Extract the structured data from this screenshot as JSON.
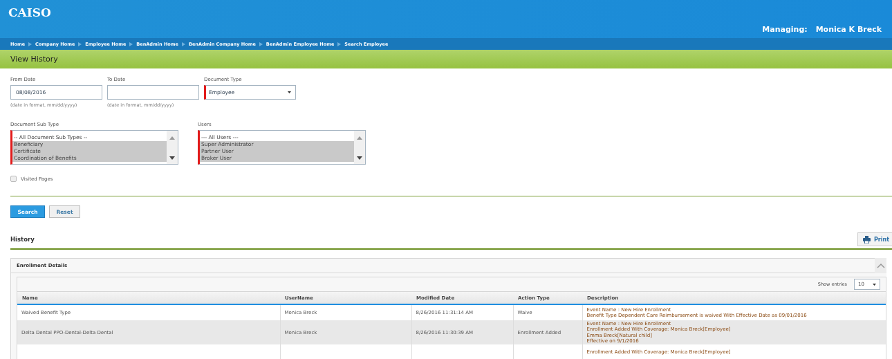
{
  "header": {
    "logo": "CAISO",
    "managing_label": "Managing:",
    "managing_name": "Monica K Breck"
  },
  "breadcrumbs": [
    "Home",
    "Company Home",
    "Employee Home",
    "BenAdmin Home",
    "BenAdmin Company Home",
    "BenAdmin Employee Home",
    "Search Employee"
  ],
  "page_title": "View History",
  "form": {
    "from_date": {
      "label": "From Date",
      "value": "08/08/2016",
      "hint": "(date in format, mm/dd/yyyy)"
    },
    "to_date": {
      "label": "To Date",
      "hint": "(date in format, mm/dd/yyyy)"
    },
    "document_type": {
      "label": "Document Type",
      "value": "Employee"
    },
    "document_sub_type": {
      "label": "Document Sub Type",
      "options": [
        {
          "label": "-- All Document Sub Types --",
          "selected": false
        },
        {
          "label": "Beneficiary",
          "selected": true
        },
        {
          "label": "Certificate",
          "selected": true
        },
        {
          "label": "Coordination of Benefits",
          "selected": true
        }
      ]
    },
    "users": {
      "label": "Users",
      "options": [
        {
          "label": "--- All Users ---",
          "selected": false
        },
        {
          "label": "Super Administrator",
          "selected": true
        },
        {
          "label": "Partner User",
          "selected": true
        },
        {
          "label": "Broker User",
          "selected": true
        }
      ]
    },
    "visited_pages": {
      "label": "Visited Pages",
      "checked": false
    },
    "buttons": [
      "Search",
      "Reset"
    ]
  },
  "history": {
    "title": "History",
    "print_button": "Print",
    "panel_title": "Enrollment Details",
    "show_entries": {
      "label": "Show entries",
      "value": "10"
    },
    "table": {
      "columns": [
        "Name",
        "UserName",
        "Modified Date",
        "Action Type",
        "Description"
      ],
      "rows": [
        {
          "name": "Waived Benefit Type",
          "username": "Monica Breck",
          "modified": "8/26/2016 11:31:14 AM",
          "action": "Waive",
          "description": [
            "Event Name : New Hire Enrollment",
            "Benefit Type Dependent Care Reimbursement is waived With Effective Date as 09/01/2016"
          ]
        },
        {
          "name": "Delta Dental PPO-Dental-Delta Dental",
          "username": "Monica Breck",
          "modified": "8/26/2016 11:30:39 AM",
          "action": "Enrollment Added",
          "description": [
            "Event Name : New Hire Enrollment",
            "Enrollment Added With Coverage: Monica Breck[Employee]",
            "Emma Breck[Natural child]",
            "Effective on 9/1/2016"
          ]
        },
        {
          "description": [
            "Enrollment Added With Coverage: Monica Breck[Employee]"
          ]
        }
      ]
    }
  }
}
